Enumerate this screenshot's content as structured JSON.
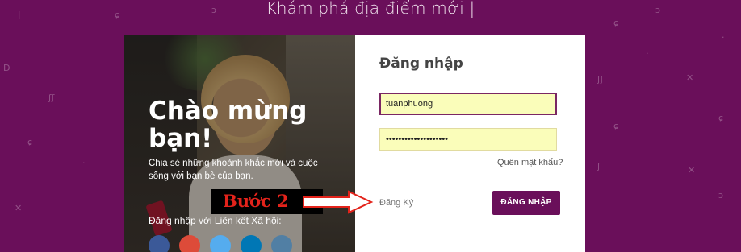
{
  "header": {
    "title": "Khám phá địa điểm mới |"
  },
  "hero": {
    "title": "Chào mừng bạn!",
    "subtitle": "Chia sẻ những khoảnh khắc mới và cuộc sống với bạn bè của bạn.",
    "social_label": "Đăng nhập với Liên kết Xã hội:",
    "social_colors": [
      "#3b5998",
      "#dd4b39",
      "#55acee",
      "#0077b5",
      "#517fa4"
    ]
  },
  "form": {
    "title": "Đăng nhập",
    "username_value": "tuanphuong",
    "password_value": "••••••••••••••••••••",
    "forgot_label": "Quên mật khẩu?",
    "register_label": "Đăng Ký",
    "login_label": "ĐĂNG NHẬP"
  },
  "annotation": {
    "step_label": "Bước 2",
    "step_color": "#e3231b"
  },
  "colors": {
    "brand": "#6a0f5a",
    "input_bg": "#fafdba",
    "input_active_border": "#7a2763"
  }
}
